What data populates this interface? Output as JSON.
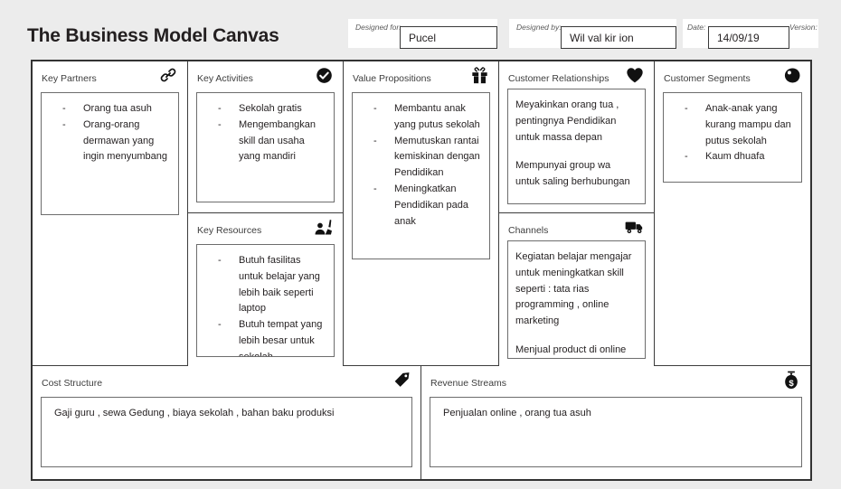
{
  "header": {
    "title": "The Business Model Canvas",
    "designed_for": {
      "label": "Designed for:",
      "value": "Pucel"
    },
    "designed_by": {
      "label": "Designed by:",
      "value": "Wil val kir ion"
    },
    "date": {
      "label": "Date:",
      "value": "14/09/19"
    },
    "version": {
      "label": "Version:"
    }
  },
  "blocks": {
    "key_partners": {
      "title": "Key Partners",
      "icon": "chain-link-icon",
      "items": [
        "Orang tua asuh",
        "Orang-orang dermawan yang ingin menyumbang"
      ]
    },
    "key_activities": {
      "title": "Key Activities",
      "icon": "check-circle-icon",
      "items": [
        "Sekolah gratis",
        "Mengembangkan skill dan usaha yang mandiri"
      ]
    },
    "key_resources": {
      "title": "Key Resources",
      "icon": "worker-icon",
      "items": [
        "Butuh fasilitas untuk belajar yang lebih baik seperti laptop",
        "Butuh tempat yang lebih besar untuk sekolah"
      ]
    },
    "value_propositions": {
      "title": "Value Propositions",
      "icon": "gift-icon",
      "items": [
        "Membantu anak yang putus sekolah",
        "Memutuskan rantai kemiskinan dengan Pendidikan",
        "Meningkatkan Pendidikan pada anak"
      ]
    },
    "customer_relationships": {
      "title": "Customer Relationships",
      "icon": "heart-icon",
      "paragraphs": [
        "Meyakinkan orang tua , pentingnya Pendidikan untuk massa depan",
        "Mempunyai group wa untuk saling berhubungan"
      ]
    },
    "channels": {
      "title": "Channels",
      "icon": "delivery-truck-icon",
      "paragraphs": [
        "Kegiatan belajar mengajar untuk meningkatkan skill seperti : tata rias programming , online marketing",
        "Menjual product di online shop seperti , tas untuk event-event"
      ]
    },
    "customer_segments": {
      "title": "Customer Segments",
      "icon": "eye-icon",
      "items": [
        "Anak-anak yang kurang mampu dan putus sekolah",
        "Kaum dhuafa"
      ]
    },
    "cost_structure": {
      "title": "Cost Structure",
      "icon": "price-tag-icon",
      "text": "Gaji guru , sewa Gedung , biaya sekolah , bahan baku produksi"
    },
    "revenue_streams": {
      "title": "Revenue Streams",
      "icon": "money-bag-icon",
      "text": "Penjualan online , orang tua asuh"
    }
  },
  "colors": {
    "page_background": "#ececec",
    "canvas_background": "#ffffff",
    "border": "#333333",
    "title_text": "#231f20",
    "block_title_text": "#3d3d3d"
  }
}
